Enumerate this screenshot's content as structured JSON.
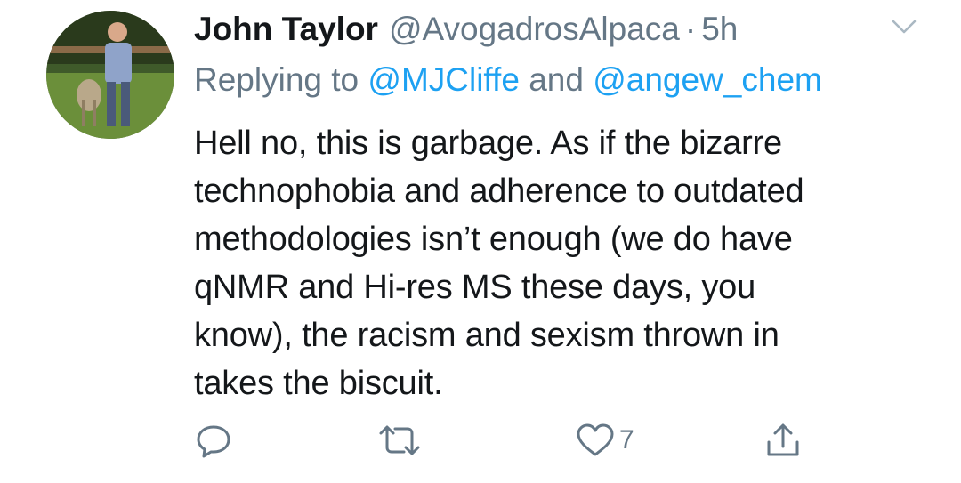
{
  "tweet": {
    "author_name": "John Taylor",
    "author_handle": "@AvogadrosAlpaca",
    "separator": "·",
    "timestamp": "5h",
    "replying_prefix": "Replying to",
    "reply_to": [
      "@MJCliffe",
      "@angew_chem"
    ],
    "reply_conjunction": "and",
    "text_lines": [
      "Hell no, this is garbage. As if the bizarre",
      "technophobia and adherence to outdated",
      "methodologies isn’t enough (we do have",
      "qNMR and Hi-res MS these days, you",
      "know), the racism and sexism thrown in",
      "takes the biscuit."
    ]
  },
  "actions": {
    "reply": {
      "icon": "speech-bubble-icon",
      "count": ""
    },
    "retweet": {
      "icon": "retweet-icon",
      "count": ""
    },
    "like": {
      "icon": "heart-icon",
      "count": "7"
    },
    "share": {
      "icon": "share-icon",
      "count": ""
    }
  },
  "menu": {
    "icon": "chevron-down-icon"
  },
  "colors": {
    "text": "#14171a",
    "secondary": "#657786",
    "link": "#1da1f2",
    "background": "#ffffff"
  }
}
